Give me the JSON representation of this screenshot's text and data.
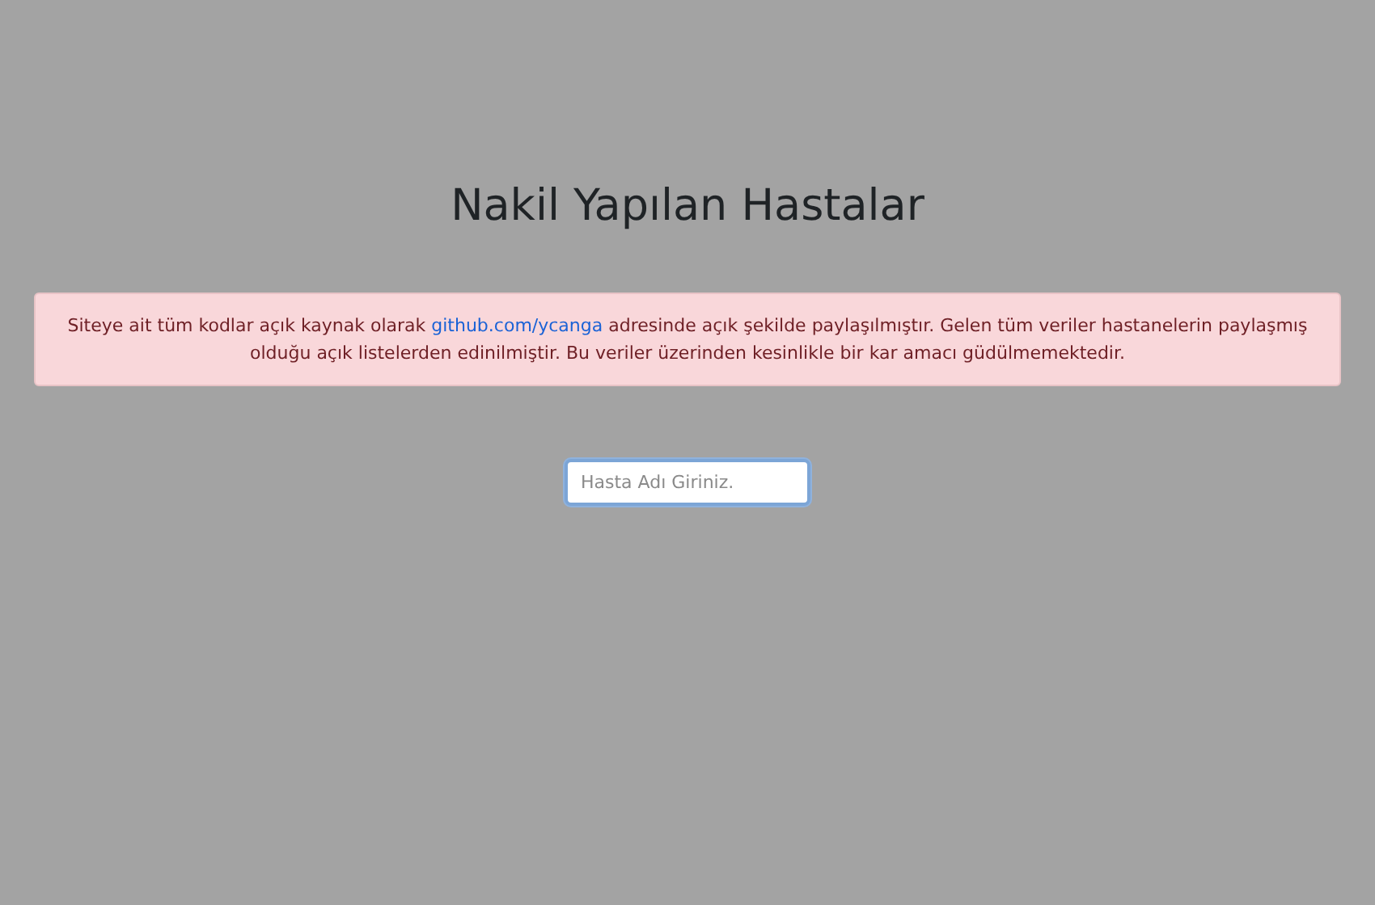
{
  "title": "Nakil Yapılan Hastalar",
  "alert": {
    "text_before": "Siteye ait tüm kodlar açık kaynak olarak ",
    "link": "github.com/ycanga",
    "text_after": " adresinde açık şekilde paylaşılmıştır. Gelen tüm veriler hastanelerin paylaşmış olduğu açık listelerden edinilmiştir. Bu veriler üzerinden kesinlikle bir kar amacı güdülmemektedir."
  },
  "search": {
    "placeholder": "Hasta Adı Giriniz."
  }
}
